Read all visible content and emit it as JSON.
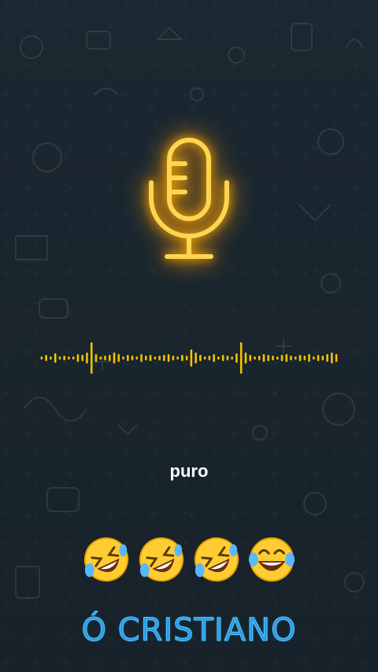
{
  "caption": "puro",
  "brand": "Ó CRISTIANO",
  "icons": {
    "mic": "microphone-icon",
    "emojis": [
      "rolling-on-floor-laughing-emoji",
      "rolling-on-floor-laughing-emoji",
      "rolling-on-floor-laughing-emoji",
      "tears-of-joy-emoji"
    ]
  },
  "colors": {
    "background": "#1b2730",
    "neon": "#ffc107",
    "waveform": "#f2c200",
    "caption": "#ffffff",
    "brand": "#2a9be0"
  }
}
